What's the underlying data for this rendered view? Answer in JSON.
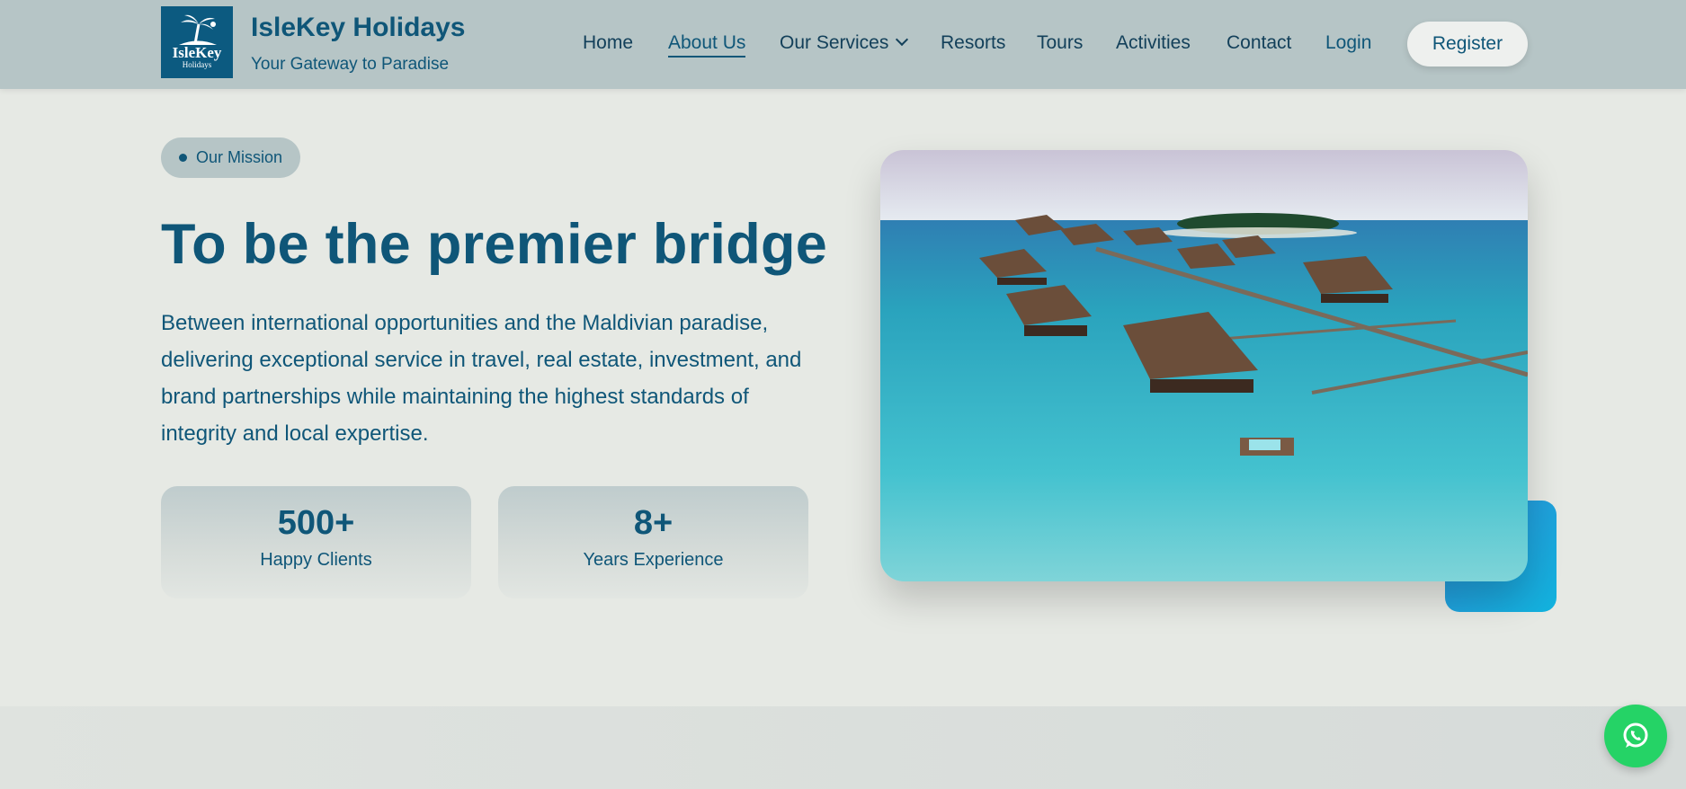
{
  "brand": {
    "logo_word": "IsleKey",
    "logo_sub": "Holidays",
    "title": "IsleKey Holidays",
    "tagline": "Your Gateway to Paradise"
  },
  "nav": {
    "items": [
      {
        "label": "Home"
      },
      {
        "label": "About Us",
        "active": true
      },
      {
        "label": "Our Services",
        "dropdown": true
      },
      {
        "label": "Resorts"
      },
      {
        "label": "Tours"
      },
      {
        "label": "Activities"
      },
      {
        "label": "Contact"
      },
      {
        "label": "Login"
      }
    ],
    "register_label": "Register"
  },
  "hero": {
    "badge": "Our Mission",
    "headline": "To be the premier bridge",
    "description": "Between international opportunities and the Maldivian paradise, delivering exceptional service in travel, real estate, investment, and brand partnerships while maintaining the highest standards of integrity and local expertise.",
    "stats": [
      {
        "value": "500+",
        "label": "Happy Clients"
      },
      {
        "value": "8+",
        "label": "Years Experience"
      }
    ],
    "image_subject": "maldives-overwater-villas-photo"
  },
  "icons": {
    "logo": "palm-tree-icon",
    "chevron": "chevron-down-icon",
    "whatsapp": "whatsapp-icon"
  },
  "colors": {
    "brand": "#0f5678",
    "header_bg": "#b6c5c6",
    "page_bg": "#e6e9e4",
    "accent": "#1fa0dd",
    "whatsapp": "#25d366"
  }
}
